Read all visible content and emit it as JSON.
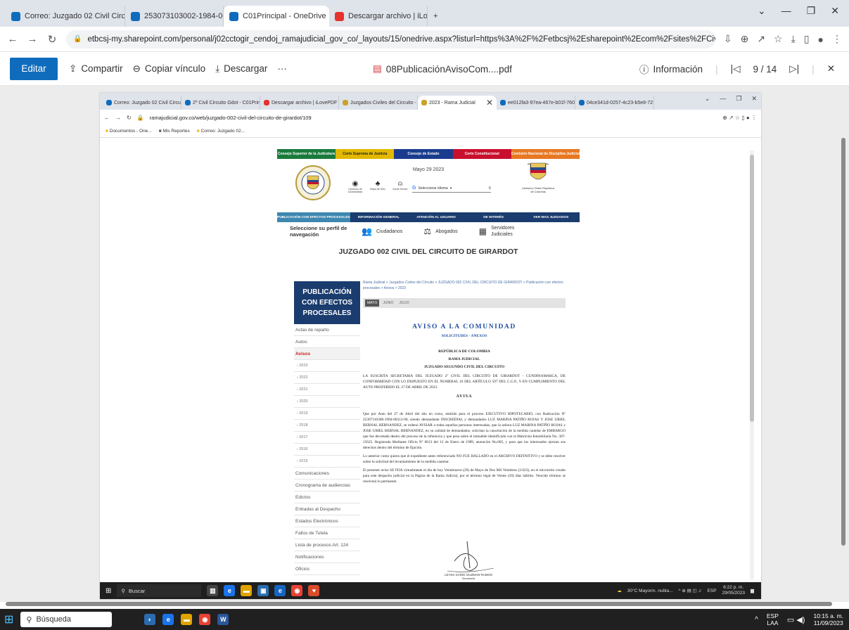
{
  "browser": {
    "tabs": [
      {
        "label": "Correo: Juzgado 02 Civil Circuito",
        "color": "#0f6cbd",
        "active": false
      },
      {
        "label": "253073103002-1984-00312-00 C",
        "color": "#0f6cbd",
        "active": false
      },
      {
        "label": "C01Principal - OneDrive",
        "color": "#0f6cbd",
        "active": true
      },
      {
        "label": "Descargar archivo | iLovePDF",
        "color": "#e5322d",
        "active": false
      }
    ],
    "new_tab": "+",
    "url": "etbcsj-my.sharepoint.com/personal/j02cctogir_cendoj_ramajudicial_gov_co/_layouts/15/onedrive.aspx?listurl=https%3A%2F%2Fetbcsj%2Esharepoint%2Ecom%2Fsites%2FCivilCircuitoGdot%2FDocumentos%20compartidos&viewid=946fc2da-..."
  },
  "onedrive": {
    "edit": "Editar",
    "share": "Compartir",
    "copy_link": "Copiar vínculo",
    "download": "Descargar",
    "more": "···",
    "filename": "08PublicaciónAvisoCom....pdf",
    "info": "Información",
    "page": "9",
    "pages": "/ 14"
  },
  "inner_browser": {
    "tabs": [
      {
        "label": "Correo: Juzgado 02 Civil Circuit",
        "color": "#0f6cbd"
      },
      {
        "label": "2º Civil Circuito Gdot - C01Princ",
        "color": "#0f6cbd"
      },
      {
        "label": "Descargar archivo | iLovePDF",
        "color": "#e5322d"
      },
      {
        "label": "Juzgados Civiles del Circuito - R",
        "color": "#c9a227"
      },
      {
        "label": "2023 - Rama Judicial",
        "color": "#c9a227",
        "active": true
      },
      {
        "label": "ee012fa3-97ea-467e-b01f-7603",
        "color": "#0f6cbd"
      },
      {
        "label": "04ce341d-0257-4c23-b5e8-721",
        "color": "#0f6cbd"
      }
    ],
    "url": "ramajudicial.gov.co/web/juzgado-002-civil-del-circuito-de-girardot/109",
    "bookmarks": [
      "Documentos - One...",
      "Mis Reportes",
      "Correo: Juzgado 02..."
    ]
  },
  "site": {
    "topnav": [
      {
        "label": "Consejo Superior de la Judicatura",
        "color": "#1a7a3c"
      },
      {
        "label": "Corte Suprema de Justicia",
        "color": "#e2b800"
      },
      {
        "label": "Consejo de Estado",
        "color": "#1b3c8e"
      },
      {
        "label": "Corte Constitucional",
        "color": "#c8102e"
      },
      {
        "label": "Comisión Nacional de Disciplina Judicial",
        "color": "#e87722"
      }
    ],
    "date": "Mayo 29 2023",
    "tools": [
      "Opciones de Accesibilidad",
      "Mapa de Sitio",
      "Iniciar Sesión"
    ],
    "language": "Seleccionar idioma",
    "motto": "Libertad y Orden República de Colombia",
    "mainnav": [
      "PUBLICACIÓN CON EFECTOS PROCESALES",
      "INFORMACIÓN GENERAL",
      "ATENCIÓN AL USUARIO",
      "DE INTERÉS",
      "VER MAS JUZGADOS"
    ],
    "profile_label": "Seleccione su perfil de navegación",
    "profiles": [
      "Ciudadanos",
      "Abogados",
      "Servidores Judiciales"
    ],
    "court": "JUZGADO 002 CIVIL DEL CIRCUITO DE GIRARDOT",
    "sidebar_title": "PUBLICACIÓN CON EFECTOS PROCESALES",
    "sidebar": [
      {
        "label": "Actas de reparto",
        "kind": "item"
      },
      {
        "label": "Autos",
        "kind": "item"
      },
      {
        "label": "Avisos",
        "kind": "red"
      },
      {
        "label": "› 2023",
        "kind": "yr"
      },
      {
        "label": "› 2022",
        "kind": "yr"
      },
      {
        "label": "› 2021",
        "kind": "yr"
      },
      {
        "label": "› 2020",
        "kind": "yr"
      },
      {
        "label": "› 2019",
        "kind": "yr"
      },
      {
        "label": "› 2018",
        "kind": "yr"
      },
      {
        "label": "› 2017",
        "kind": "yr"
      },
      {
        "label": "› 2016",
        "kind": "yr"
      },
      {
        "label": "› 2015",
        "kind": "yr"
      },
      {
        "label": "Comunicaciones",
        "kind": "item"
      },
      {
        "label": "Cronograma de audiencias",
        "kind": "item"
      },
      {
        "label": "Edictos",
        "kind": "item"
      },
      {
        "label": "Entradas al Despacho",
        "kind": "item"
      },
      {
        "label": "Estados Electrónicos",
        "kind": "item"
      },
      {
        "label": "Fallos de Tutela",
        "kind": "item"
      },
      {
        "label": "Lista de procesos Art. 124",
        "kind": "item"
      },
      {
        "label": "Notificaciones",
        "kind": "item"
      },
      {
        "label": "Oficios",
        "kind": "item"
      }
    ],
    "breadcrumb": "Rama Judicial > Juzgados Civiles del Circuito > JUZGADO 002 CIVIL DEL CIRCUITO DE GIRARDOT > Publicación con efectos procesales > Avisos > 2023",
    "months": [
      "MAYO",
      "JUNIO",
      "JULIO"
    ],
    "aviso_title": "AVISO A LA COMUNIDAD",
    "aviso_sub": "SOLICITUDES - ANEXOS",
    "heading1": "REPÚBLICA DE COLOMBIA",
    "heading2": "RAMA JUDICIAL",
    "heading3": "JUZGADO SEGUNDO CIVIL DEL CIRCUITO",
    "intro": "LA SUSCRITA SECRETARIA DEL JUZGADO 2º CIVIL DEL CIRCUITO DE GIRARDOT - CUNDINAMARCA, DE CONFORMIDAD CON LO DISPUESTO EN EL NUMERAL 10 DEL ARTÍCULO 597 DEL C.G.P., Y EN CUMPLIMIENTO DEL AUTO PROFERIDO EL 27 DE ABRIL DE 2023.",
    "avisa": "AVISA",
    "body1": "Que por Auto del 27 de Abril del año en curso, emitido para el proceso EJECUTIVO HIPOTECARIO, con Radicación Nº 25307310300-1984-00312-00, siendo demandante INSCREDIAL y demandados LUZ MARINA PATIÑO ROJAS Y JOSE URIEL BERNAL HERNANDEZ, se ordenó AVISAR a todas aquellas personas interesadas, que la señora LUZ MARINA PATIÑO ROJAS y JOSE URIEL BERNAL HERNANDEZ, en su calidad de demandados, solicitan la cancelación de la medida cautelar de EMBARGO que fue decretada dentro del proceso de la referencia y que pesa sobre el inmueble identificado con la Matrícula Inmobiliaria No. 307-15625. Registrada Mediante Oficio Nº 0013 del 12 de Enero de 1989, anotación No.005, y para que los interesados ejerzan sus derechos dentro del término de fijación.",
    "body2": "Lo anterior como quiera que el expediente antes referenciado NO FUE HALLADO en el ARCHIVO DEFINITIVO y se debe resolver sobre la solicitud del levantamiento de la medida cautelar.",
    "body3": "El presente aviso SE FIJA virtualmente el día de hoy Veintinueve (29) de Mayo de Dos Mil Veintitres (2.023), en el micrositio creado para este despacho judicial en la Página de la Rama Judicial, por el término legal de Veinte (20) días hábiles. Vencido término se resolverá lo pertinente.",
    "signature": "LEYDA SARID GUZMAN RAMOS",
    "signature_role": "Secretaria"
  },
  "inner_taskbar": {
    "search": "Buscar",
    "weather": "30°C  Mayorm. nubla...",
    "lang": "ESP",
    "time": "6:22 p. m.",
    "date": "29/05/2023"
  },
  "taskbar": {
    "search": "Búsqueda",
    "lang": "ESP",
    "lang2": "LAA",
    "time": "10:15 a. m.",
    "date": "11/09/2023"
  }
}
